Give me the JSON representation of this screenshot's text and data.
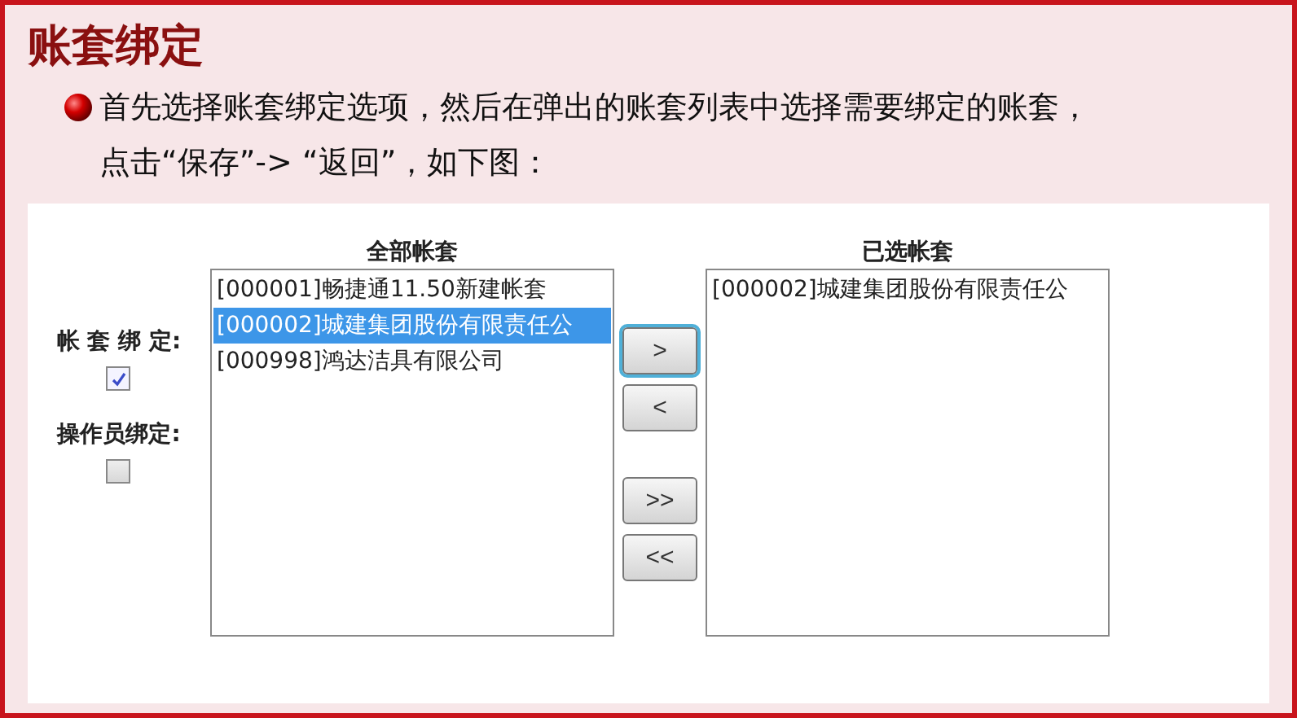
{
  "title": "账套绑定",
  "instructions": [
    "首先选择账套绑定选项，然后在弹出的账套列表中选择需要绑定的账套，",
    "点击“保存”-> “返回”，如下图："
  ],
  "options": [
    {
      "label": "帐 套 绑 定:",
      "checked": true
    },
    {
      "label": "操作员绑定:",
      "checked": false
    }
  ],
  "all_list": {
    "heading": "全部帐套",
    "items": [
      {
        "label": "[000001]畅捷通11.50新建帐套",
        "selected": false
      },
      {
        "label": "[000002]城建集团股份有限责任公",
        "selected": true
      },
      {
        "label": "[000998]鸿达洁具有限公司",
        "selected": false
      }
    ]
  },
  "buttons": [
    {
      "label": ">",
      "focused": true
    },
    {
      "label": "<",
      "focused": false
    },
    {
      "label": ">>",
      "focused": false
    },
    {
      "label": "<<",
      "focused": false
    }
  ],
  "chosen_list": {
    "heading": "已选帐套",
    "items": [
      {
        "label": "[000002]城建集团股份有限责任公",
        "selected": false
      }
    ]
  }
}
